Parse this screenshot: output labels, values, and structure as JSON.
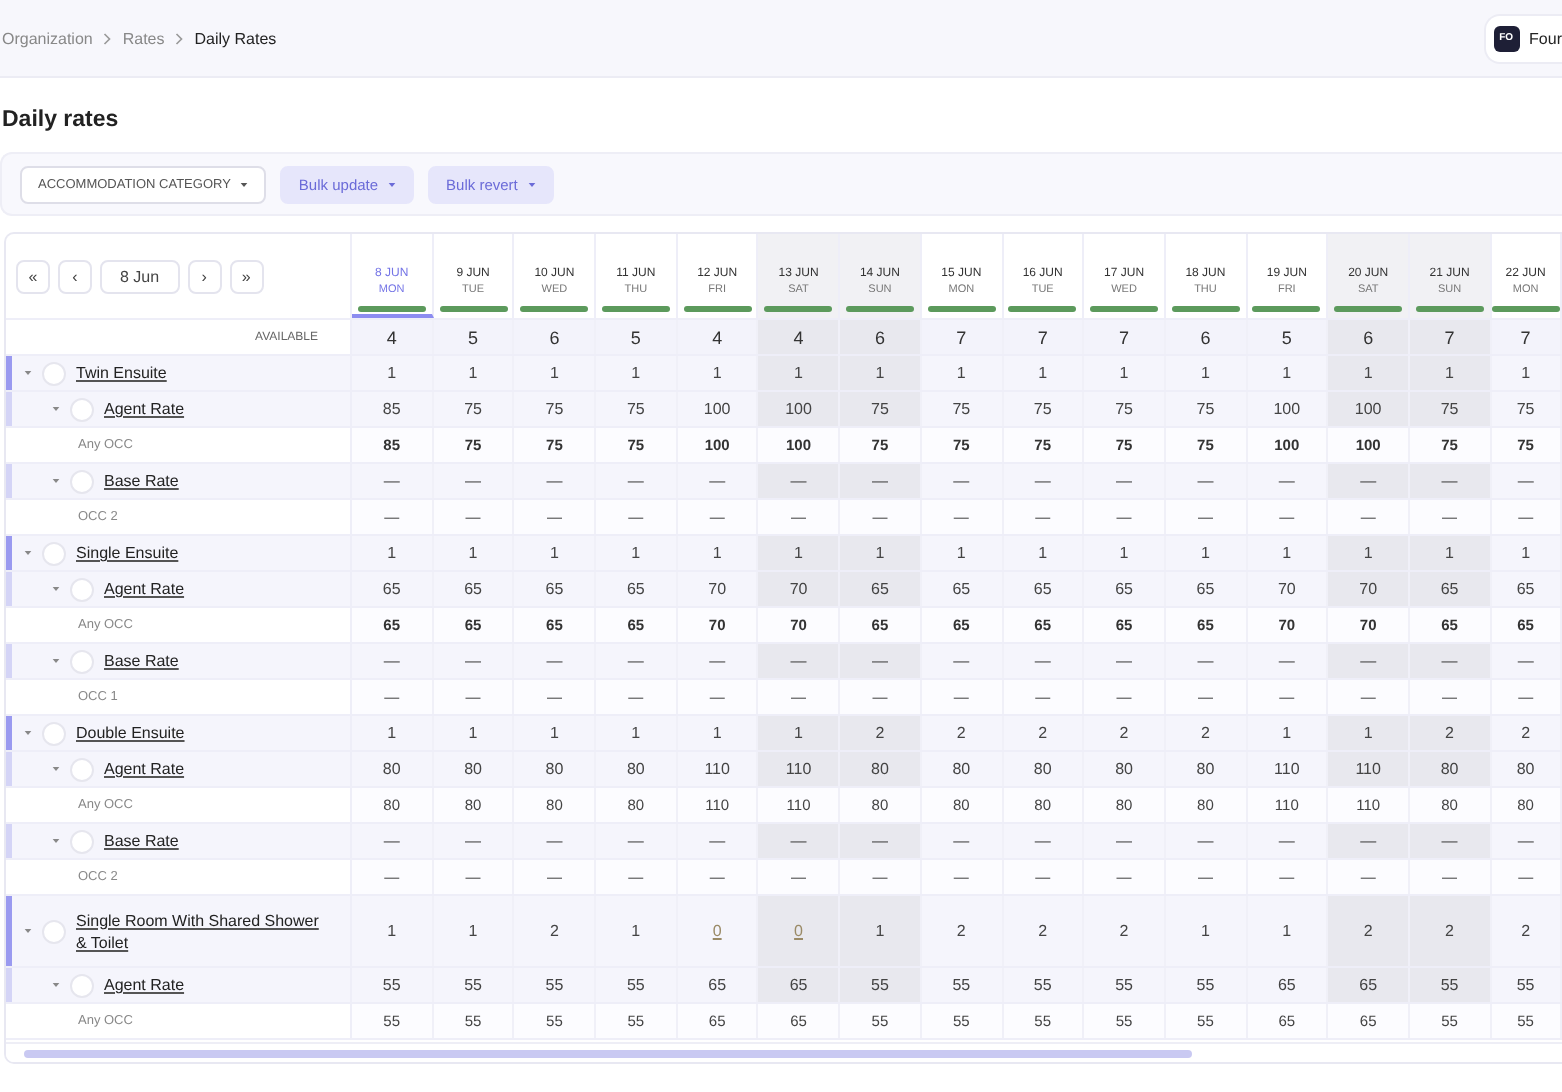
{
  "breadcrumb": [
    "Organization",
    "Rates",
    "Daily Rates"
  ],
  "account": {
    "initials": "FO",
    "name": "Four"
  },
  "page_title": "Daily rates",
  "toolbar": [
    {
      "label": "ACCOMMODATION CATEGORY",
      "kind": "outline"
    },
    {
      "label": "Bulk update",
      "kind": "tinted"
    },
    {
      "label": "Bulk revert",
      "kind": "tinted"
    }
  ],
  "date_nav": {
    "first": "«",
    "prev": "‹",
    "date": "8 Jun",
    "next": "›",
    "last": "»"
  },
  "available_label": "AVAILABLE",
  "columns": [
    {
      "date": "8 JUN",
      "day": "MON",
      "selected": true,
      "weekend": false
    },
    {
      "date": "9 JUN",
      "day": "TUE",
      "selected": false,
      "weekend": false
    },
    {
      "date": "10 JUN",
      "day": "WED",
      "selected": false,
      "weekend": false
    },
    {
      "date": "11 JUN",
      "day": "THU",
      "selected": false,
      "weekend": false
    },
    {
      "date": "12 JUN",
      "day": "FRI",
      "selected": false,
      "weekend": false
    },
    {
      "date": "13 JUN",
      "day": "SAT",
      "selected": false,
      "weekend": true
    },
    {
      "date": "14 JUN",
      "day": "SUN",
      "selected": false,
      "weekend": true
    },
    {
      "date": "15 JUN",
      "day": "MON",
      "selected": false,
      "weekend": false
    },
    {
      "date": "16 JUN",
      "day": "TUE",
      "selected": false,
      "weekend": false
    },
    {
      "date": "17 JUN",
      "day": "WED",
      "selected": false,
      "weekend": false
    },
    {
      "date": "18 JUN",
      "day": "THU",
      "selected": false,
      "weekend": false
    },
    {
      "date": "19 JUN",
      "day": "FRI",
      "selected": false,
      "weekend": false
    },
    {
      "date": "20 JUN",
      "day": "SAT",
      "selected": false,
      "weekend": true
    },
    {
      "date": "21 JUN",
      "day": "SUN",
      "selected": false,
      "weekend": true
    },
    {
      "date": "22 JUN",
      "day": "MON",
      "selected": false,
      "weekend": false
    }
  ],
  "available": [
    "4",
    "5",
    "6",
    "5",
    "4",
    "4",
    "6",
    "7",
    "7",
    "7",
    "6",
    "5",
    "6",
    "7",
    "7"
  ],
  "rooms": [
    {
      "name": "Twin Ensuite",
      "expanded": true,
      "checked": false,
      "values": [
        "1",
        "1",
        "1",
        "1",
        "1",
        "1",
        "1",
        "1",
        "1",
        "1",
        "1",
        "1",
        "1",
        "1",
        "1"
      ],
      "rates": [
        {
          "name": "Agent Rate",
          "expanded": true,
          "checked": false,
          "values": [
            "85",
            "75",
            "75",
            "75",
            "100",
            "100",
            "75",
            "75",
            "75",
            "75",
            "75",
            "100",
            "100",
            "75",
            "75"
          ],
          "occupancy": {
            "label": "Any OCC",
            "bold": true,
            "values": [
              "85",
              "75",
              "75",
              "75",
              "100",
              "100",
              "75",
              "75",
              "75",
              "75",
              "75",
              "100",
              "100",
              "75",
              "75"
            ]
          }
        },
        {
          "name": "Base Rate",
          "expanded": true,
          "checked": false,
          "values": [
            "—",
            "—",
            "—",
            "—",
            "—",
            "—",
            "—",
            "—",
            "—",
            "—",
            "—",
            "—",
            "—",
            "—",
            "—"
          ],
          "occupancy": {
            "label": "OCC 2",
            "bold": false,
            "values": [
              "—",
              "—",
              "—",
              "—",
              "—",
              "—",
              "—",
              "—",
              "—",
              "—",
              "—",
              "—",
              "—",
              "—",
              "—"
            ]
          }
        }
      ]
    },
    {
      "name": "Single Ensuite",
      "expanded": true,
      "checked": false,
      "values": [
        "1",
        "1",
        "1",
        "1",
        "1",
        "1",
        "1",
        "1",
        "1",
        "1",
        "1",
        "1",
        "1",
        "1",
        "1"
      ],
      "rates": [
        {
          "name": "Agent Rate",
          "expanded": true,
          "checked": false,
          "values": [
            "65",
            "65",
            "65",
            "65",
            "70",
            "70",
            "65",
            "65",
            "65",
            "65",
            "65",
            "70",
            "70",
            "65",
            "65"
          ],
          "occupancy": {
            "label": "Any OCC",
            "bold": true,
            "values": [
              "65",
              "65",
              "65",
              "65",
              "70",
              "70",
              "65",
              "65",
              "65",
              "65",
              "65",
              "70",
              "70",
              "65",
              "65"
            ]
          }
        },
        {
          "name": "Base Rate",
          "expanded": true,
          "checked": false,
          "values": [
            "—",
            "—",
            "—",
            "—",
            "—",
            "—",
            "—",
            "—",
            "—",
            "—",
            "—",
            "—",
            "—",
            "—",
            "—"
          ],
          "occupancy": {
            "label": "OCC 1",
            "bold": false,
            "values": [
              "—",
              "—",
              "—",
              "—",
              "—",
              "—",
              "—",
              "—",
              "—",
              "—",
              "—",
              "—",
              "—",
              "—",
              "—"
            ]
          }
        }
      ]
    },
    {
      "name": "Double Ensuite",
      "expanded": true,
      "checked": false,
      "values": [
        "1",
        "1",
        "1",
        "1",
        "1",
        "1",
        "2",
        "2",
        "2",
        "2",
        "2",
        "1",
        "1",
        "2",
        "2"
      ],
      "rates": [
        {
          "name": "Agent Rate",
          "expanded": true,
          "checked": false,
          "values": [
            "80",
            "80",
            "80",
            "80",
            "110",
            "110",
            "80",
            "80",
            "80",
            "80",
            "80",
            "110",
            "110",
            "80",
            "80"
          ],
          "occupancy": {
            "label": "Any OCC",
            "bold": false,
            "values": [
              "80",
              "80",
              "80",
              "80",
              "110",
              "110",
              "80",
              "80",
              "80",
              "80",
              "80",
              "110",
              "110",
              "80",
              "80"
            ]
          }
        },
        {
          "name": "Base Rate",
          "expanded": true,
          "checked": false,
          "values": [
            "—",
            "—",
            "—",
            "—",
            "—",
            "—",
            "—",
            "—",
            "—",
            "—",
            "—",
            "—",
            "—",
            "—",
            "—"
          ],
          "occupancy": {
            "label": "OCC 2",
            "bold": false,
            "values": [
              "—",
              "—",
              "—",
              "—",
              "—",
              "—",
              "—",
              "—",
              "—",
              "—",
              "—",
              "—",
              "—",
              "—",
              "—"
            ]
          }
        }
      ]
    },
    {
      "name": "Single Room With Shared Shower & Toilet",
      "expanded": true,
      "checked": false,
      "values": [
        "1",
        "1",
        "2",
        "1",
        {
          "value": "0",
          "sold_out": true
        },
        {
          "value": "0",
          "sold_out": true
        },
        "1",
        "2",
        "2",
        "2",
        "1",
        "1",
        "2",
        "2",
        "2"
      ],
      "rates": [
        {
          "name": "Agent Rate",
          "expanded": true,
          "checked": false,
          "values": [
            "55",
            "55",
            "55",
            "55",
            "65",
            "65",
            "55",
            "55",
            "55",
            "55",
            "55",
            "65",
            "65",
            "55",
            "55"
          ],
          "occupancy": {
            "label": "Any OCC",
            "bold": false,
            "values": [
              "55",
              "55",
              "55",
              "55",
              "65",
              "65",
              "55",
              "55",
              "55",
              "55",
              "55",
              "65",
              "65",
              "55",
              "55"
            ]
          }
        }
      ]
    }
  ]
}
